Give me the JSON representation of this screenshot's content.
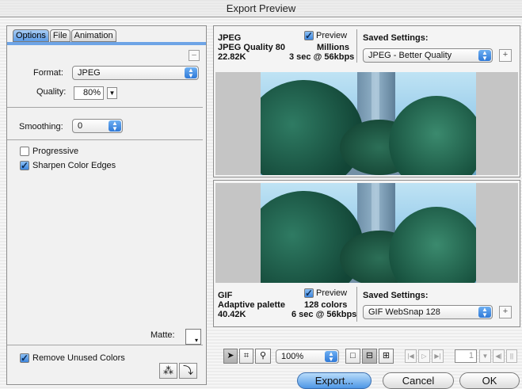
{
  "window": {
    "title": "Export Preview"
  },
  "tabs": [
    {
      "label": "Options",
      "active": true
    },
    {
      "label": "File",
      "active": false
    },
    {
      "label": "Animation",
      "active": false
    }
  ],
  "options": {
    "format_label": "Format:",
    "format_value": "JPEG",
    "quality_label": "Quality:",
    "quality_value": "80%",
    "smoothing_label": "Smoothing:",
    "smoothing_value": "0",
    "progressive_label": "Progressive",
    "progressive_checked": false,
    "sharpen_label": "Sharpen Color Edges",
    "sharpen_checked": true,
    "matte_label": "Matte:",
    "remove_unused_label": "Remove Unused Colors",
    "remove_unused_checked": true
  },
  "preview_top": {
    "format": "JPEG",
    "quality": "JPEG Quality 80",
    "size": "22.82K",
    "time": "3 sec @ 56kbps",
    "colors": "Millions",
    "preview_label": "Preview",
    "preview_checked": true,
    "saved_settings_label": "Saved Settings:",
    "saved_settings_value": "JPEG - Better Quality"
  },
  "preview_bottom": {
    "format": "GIF",
    "palette": "Adaptive palette",
    "size": "40.42K",
    "time": "6 sec @ 56kbps",
    "colors": "128 colors",
    "preview_label": "Preview",
    "preview_checked": true,
    "saved_settings_label": "Saved Settings:",
    "saved_settings_value": "GIF WebSnap 128"
  },
  "toolbar": {
    "zoom_value": "100%",
    "frame_value": "1"
  },
  "buttons": {
    "export": "Export...",
    "cancel": "Cancel",
    "ok": "OK"
  },
  "colors": {
    "accent": "#5d9ce6",
    "default_button": "#4e97e6"
  }
}
